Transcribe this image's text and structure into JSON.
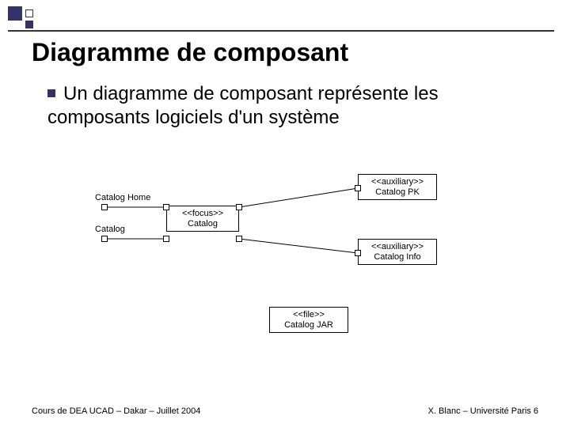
{
  "slide": {
    "title": "Diagramme de composant",
    "bullet_text": "Un diagramme de composant représente les composants logiciels d'un système"
  },
  "diagram": {
    "interfaces": {
      "home": "Catalog Home",
      "catalog": "Catalog"
    },
    "components": {
      "focus": {
        "stereotype": "<<focus>>",
        "name": "Catalog"
      },
      "pk": {
        "stereotype": "<<auxiliary>>",
        "name": "Catalog PK"
      },
      "info": {
        "stereotype": "<<auxiliary>>",
        "name": "Catalog Info"
      },
      "file": {
        "stereotype": "<<file>>",
        "name": "Catalog JAR"
      }
    }
  },
  "footer": {
    "left": "Cours de DEA UCAD – Dakar – Juillet 2004",
    "right": "X. Blanc – Université Paris 6"
  }
}
